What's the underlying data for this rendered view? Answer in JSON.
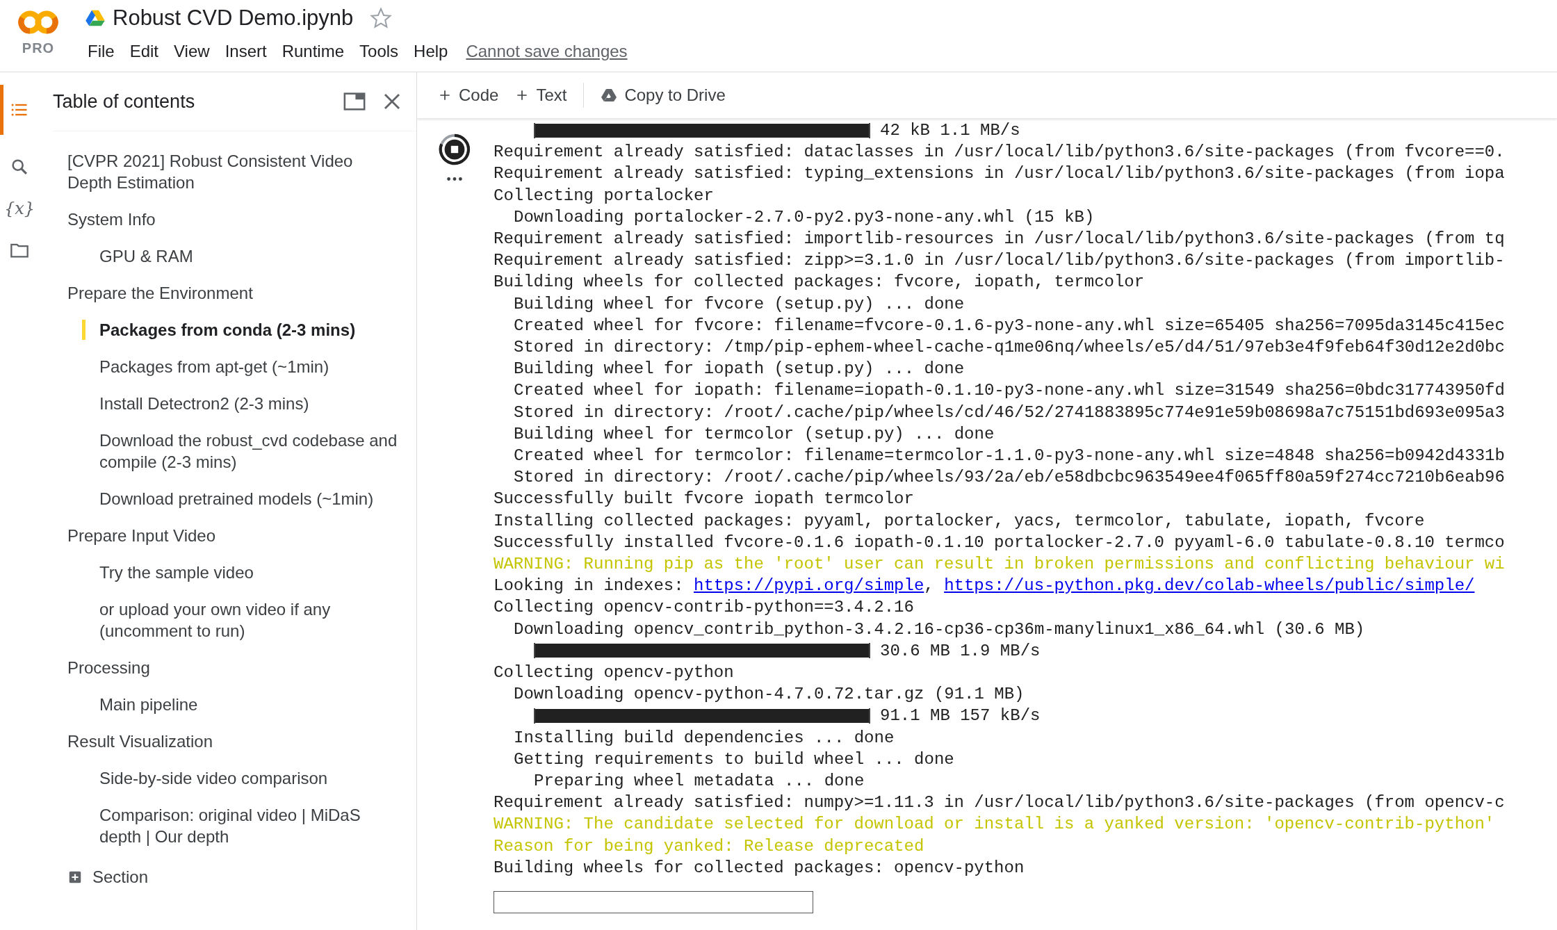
{
  "header": {
    "logo_text": "PRO",
    "title": "Robust CVD Demo.ipynb",
    "starred": false,
    "menu": [
      "File",
      "Edit",
      "View",
      "Insert",
      "Runtime",
      "Tools",
      "Help"
    ],
    "notice": "Cannot save changes"
  },
  "rail": [
    {
      "kind": "toc",
      "selected": true
    },
    {
      "kind": "search",
      "selected": false
    },
    {
      "kind": "variables",
      "label": "{x}",
      "selected": false
    },
    {
      "kind": "files",
      "selected": false
    }
  ],
  "toc": {
    "title": "Table of contents",
    "items": [
      {
        "label": "[CVPR 2021] Robust Consistent Video Depth Estimation",
        "selected": false
      },
      {
        "label": "System Info",
        "selected": false,
        "children": [
          {
            "label": "GPU & RAM",
            "selected": false
          }
        ]
      },
      {
        "label": "Prepare the Environment",
        "selected": false,
        "children": [
          {
            "label": "Packages from conda (2-3 mins)",
            "selected": true
          },
          {
            "label": "Packages from apt-get (~1min)",
            "selected": false
          },
          {
            "label": "Install Detectron2 (2-3 mins)",
            "selected": false
          },
          {
            "label": "Download the robust_cvd codebase and compile (2-3 mins)",
            "selected": false
          },
          {
            "label": "Download pretrained models (~1min)",
            "selected": false
          }
        ]
      },
      {
        "label": "Prepare Input Video",
        "selected": false,
        "children": [
          {
            "label": "Try the sample video",
            "selected": false
          },
          {
            "label": "or upload your own video if any (uncomment to run)",
            "selected": false
          }
        ]
      },
      {
        "label": "Processing",
        "selected": false,
        "children": [
          {
            "label": "Main pipeline",
            "selected": false
          }
        ]
      },
      {
        "label": "Result Visualization",
        "selected": false,
        "children": [
          {
            "label": "Side-by-side video comparison",
            "selected": false
          },
          {
            "label": "Comparison: original video | MiDaS depth | Our depth",
            "selected": false
          }
        ]
      }
    ],
    "add_label": "Section"
  },
  "toolbar": [
    {
      "kind": "add",
      "label": "Code"
    },
    {
      "kind": "add",
      "label": "Text"
    },
    {
      "kind": "drive",
      "label": "Copy to Drive"
    }
  ],
  "output": {
    "running": true,
    "lines": [
      {
        "kind": "progress",
        "level": 1,
        "reading": "42 kB 1.1 MB/s"
      },
      {
        "kind": "plain",
        "text": "Requirement already satisfied: dataclasses in /usr/local/lib/python3.6/site-packages (from fvcore==0."
      },
      {
        "kind": "plain",
        "text": "Requirement already satisfied: typing_extensions in /usr/local/lib/python3.6/site-packages (from iopa"
      },
      {
        "kind": "plain",
        "text": "Collecting portalocker"
      },
      {
        "kind": "sub",
        "text": "Downloading portalocker-2.7.0-py2.py3-none-any.whl (15 kB)"
      },
      {
        "kind": "plain",
        "text": "Requirement already satisfied: importlib-resources in /usr/local/lib/python3.6/site-packages (from tq"
      },
      {
        "kind": "plain",
        "text": "Requirement already satisfied: zipp>=3.1.0 in /usr/local/lib/python3.6/site-packages (from importlib-"
      },
      {
        "kind": "plain",
        "text": "Building wheels for collected packages: fvcore, iopath, termcolor"
      },
      {
        "kind": "sub",
        "text": "Building wheel for fvcore (setup.py) ... done"
      },
      {
        "kind": "sub",
        "text": "Created wheel for fvcore: filename=fvcore-0.1.6-py3-none-any.whl size=65405 sha256=7095da3145c415ec"
      },
      {
        "kind": "sub",
        "text": "Stored in directory: /tmp/pip-ephem-wheel-cache-q1me06nq/wheels/e5/d4/51/97eb3e4f9feb64f30d12e2d0bc"
      },
      {
        "kind": "sub",
        "text": "Building wheel for iopath (setup.py) ... done"
      },
      {
        "kind": "sub",
        "text": "Created wheel for iopath: filename=iopath-0.1.10-py3-none-any.whl size=31549 sha256=0bdc317743950fd"
      },
      {
        "kind": "sub",
        "text": "Stored in directory: /root/.cache/pip/wheels/cd/46/52/2741883895c774e91e59b08698a7c75151bd693e095a3"
      },
      {
        "kind": "sub",
        "text": "Building wheel for termcolor (setup.py) ... done"
      },
      {
        "kind": "sub",
        "text": "Created wheel for termcolor: filename=termcolor-1.1.0-py3-none-any.whl size=4848 sha256=b0942d4331b"
      },
      {
        "kind": "sub",
        "text": "Stored in directory: /root/.cache/pip/wheels/93/2a/eb/e58dbcbc963549ee4f065ff80a59f274cc7210b6eab96"
      },
      {
        "kind": "plain",
        "text": "Successfully built fvcore iopath termcolor"
      },
      {
        "kind": "plain",
        "text": "Installing collected packages: pyyaml, portalocker, yacs, termcolor, tabulate, iopath, fvcore"
      },
      {
        "kind": "plain",
        "text": "Successfully installed fvcore-0.1.6 iopath-0.1.10 portalocker-2.7.0 pyyaml-6.0 tabulate-0.8.10 termco"
      },
      {
        "kind": "warning",
        "text": "WARNING: Running pip as the 'root' user can result in broken permissions and conflicting behaviour wi"
      },
      {
        "kind": "links",
        "parts": [
          {
            "text": "Looking in indexes: "
          },
          {
            "link": "https://pypi.org/simple"
          },
          {
            "text": ", "
          },
          {
            "link": "https://us-python.pkg.dev/colab-wheels/public/simple/"
          }
        ]
      },
      {
        "kind": "plain",
        "text": "Collecting opencv-contrib-python==3.4.2.16"
      },
      {
        "kind": "sub",
        "text": "Downloading opencv_contrib_python-3.4.2.16-cp36-cp36m-manylinux1_x86_64.whl (30.6 MB)"
      },
      {
        "kind": "progress",
        "level": 1,
        "reading": "30.6 MB 1.9 MB/s"
      },
      {
        "kind": "plain",
        "text": "Collecting opencv-python"
      },
      {
        "kind": "sub",
        "text": "Downloading opencv-python-4.7.0.72.tar.gz (91.1 MB)"
      },
      {
        "kind": "progress",
        "level": 1,
        "reading": "91.1 MB 157 kB/s"
      },
      {
        "kind": "sub",
        "text": "Installing build dependencies ... done"
      },
      {
        "kind": "sub",
        "text": "Getting requirements to build wheel ... done"
      },
      {
        "kind": "subsub",
        "text": "Preparing wheel metadata ... done"
      },
      {
        "kind": "plain",
        "text": "Requirement already satisfied: numpy>=1.11.3 in /usr/local/lib/python3.6/site-packages (from opencv-c"
      },
      {
        "kind": "warning",
        "text": "WARNING: The candidate selected for download or install is a yanked version: 'opencv-contrib-python'"
      },
      {
        "kind": "warning",
        "text": "Reason for being yanked: Release deprecated"
      },
      {
        "kind": "plain",
        "text": "Building wheels for collected packages: opencv-python"
      }
    ]
  }
}
